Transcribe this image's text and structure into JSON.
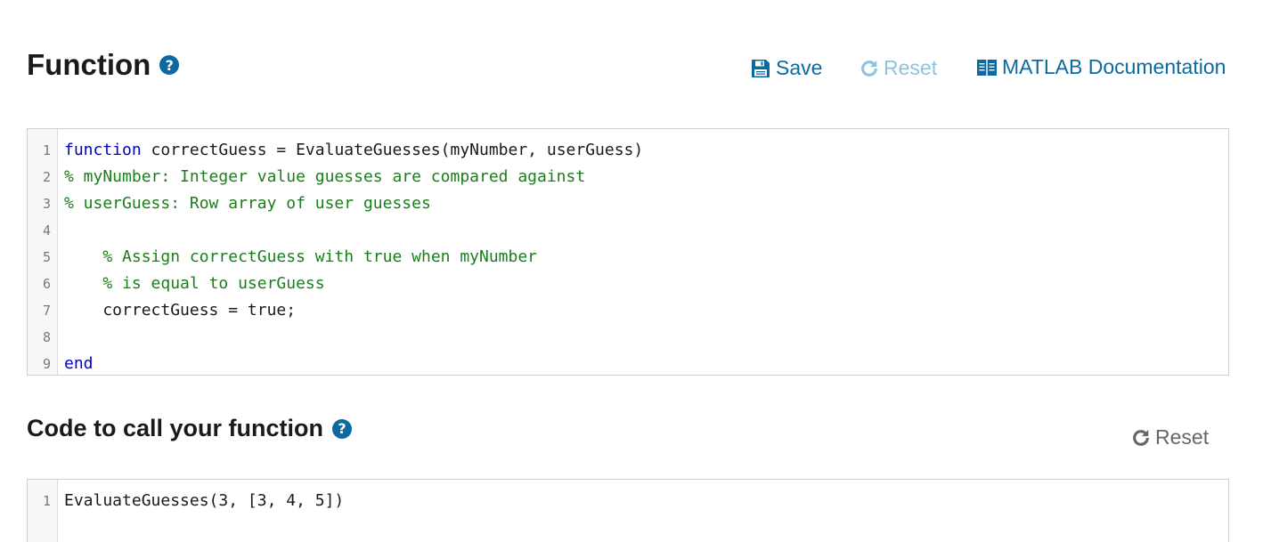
{
  "function_section": {
    "title": "Function",
    "help_glyph": "?",
    "toolbar": {
      "save_label": "Save",
      "reset_label": "Reset",
      "docs_label": "MATLAB Documentation"
    },
    "code_lines": [
      {
        "num": "1",
        "parts": [
          {
            "cls": "kw",
            "text": "function"
          },
          {
            "cls": "",
            "text": " correctGuess = EvaluateGuesses(myNumber, userGuess)"
          }
        ]
      },
      {
        "num": "2",
        "parts": [
          {
            "cls": "cm",
            "text": "% myNumber: Integer value guesses are compared against"
          }
        ]
      },
      {
        "num": "3",
        "parts": [
          {
            "cls": "cm",
            "text": "% userGuess: Row array of user guesses"
          }
        ]
      },
      {
        "num": "4",
        "parts": []
      },
      {
        "num": "5",
        "parts": [
          {
            "cls": "",
            "text": "    "
          },
          {
            "cls": "cm",
            "text": "% Assign correctGuess with true when myNumber"
          }
        ]
      },
      {
        "num": "6",
        "parts": [
          {
            "cls": "",
            "text": "    "
          },
          {
            "cls": "cm",
            "text": "% is equal to userGuess"
          }
        ]
      },
      {
        "num": "7",
        "parts": [
          {
            "cls": "",
            "text": "    correctGuess = true;"
          }
        ]
      },
      {
        "num": "8",
        "parts": []
      },
      {
        "num": "9",
        "parts": [
          {
            "cls": "kw",
            "text": "end"
          }
        ]
      }
    ]
  },
  "call_section": {
    "title": "Code to call your function",
    "help_glyph": "?",
    "reset_label": "Reset",
    "code_lines": [
      {
        "num": "1",
        "parts": [
          {
            "cls": "",
            "text": "EvaluateGuesses(3, [3, 4, 5])"
          }
        ]
      }
    ]
  },
  "colors": {
    "accent": "#0a6aa1",
    "reset_disabled": "#8cc3de",
    "reset_enabled": "#666666",
    "keyword": "#0000c8",
    "comment": "#1a7f1a"
  },
  "icons": {
    "help": "question-circle-icon",
    "save": "floppy-disk-icon",
    "reset": "circular-arrow-icon",
    "docs": "book-icon"
  }
}
